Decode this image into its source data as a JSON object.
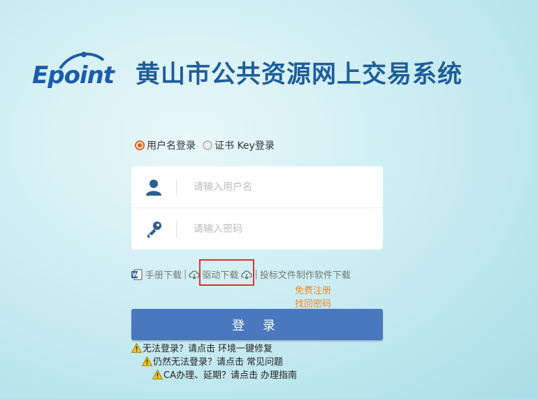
{
  "header": {
    "logo_text": "Epoint",
    "title": "黄山市公共资源网上交易系统"
  },
  "login_tabs": {
    "username": "用户名登录",
    "cert": "证书 Key登录"
  },
  "form": {
    "username_placeholder": "请输入用户名",
    "password_placeholder": "请输入密码"
  },
  "links": {
    "manual": "手册下载",
    "driver": "驱动下载",
    "bid_software": "投标文件制作软件下载",
    "sep": "|"
  },
  "account": {
    "register": "免费注册",
    "forgot": "找回密码"
  },
  "login_button": "登 录",
  "help": [
    {
      "prompt": "无法登录？请点击",
      "action": "环境一键修复"
    },
    {
      "prompt": "仍然无法登录？请点击",
      "action": "常见问题"
    },
    {
      "prompt": "CA办理、延期？请点击",
      "action": "办理指南"
    }
  ],
  "colors": {
    "brand": "#1f5d9a",
    "button": "#4a78bf",
    "link_orange": "#f08a24",
    "radio_active": "#e0641b",
    "highlight": "#d9332b"
  },
  "icons": [
    "user-icon",
    "key-icon",
    "word-doc-icon",
    "cloud-download-icon",
    "warning-icon"
  ]
}
